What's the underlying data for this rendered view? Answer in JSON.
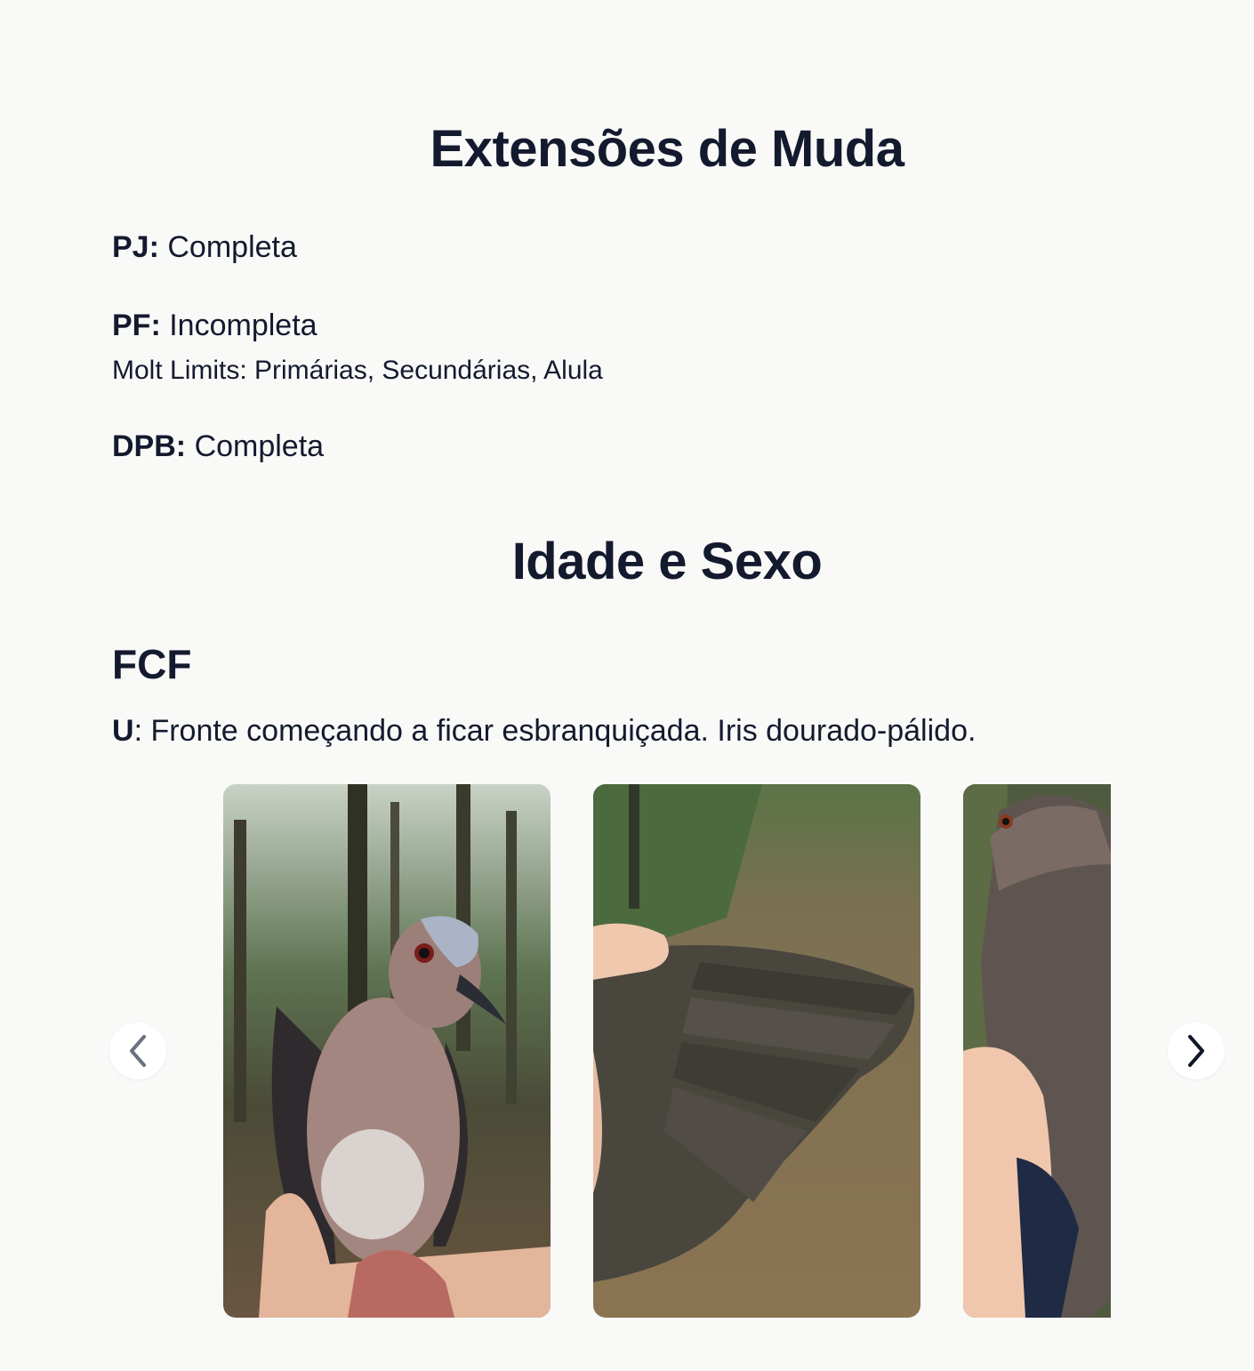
{
  "molt": {
    "title": "Extensões de Muda",
    "pj": {
      "label": "PJ:",
      "value": "Completa"
    },
    "pf": {
      "label": "PF:",
      "value": "Incompleta",
      "limits": "Molt Limits: Primárias, Secundárias, Alula"
    },
    "dpb": {
      "label": "DPB:",
      "value": "Completa"
    }
  },
  "age_sex": {
    "title": "Idade e Sexo",
    "code": "FCF",
    "desc_label": "U",
    "desc_text": ": Fronte começando a ficar esbranquiçada. Iris dourado-pálido."
  },
  "carousel": {
    "images": [
      "bird-front-photo",
      "bird-spread-wing-photo",
      "bird-side-photo"
    ],
    "prev_icon": "chevron-left-icon",
    "next_icon": "chevron-right-icon"
  }
}
